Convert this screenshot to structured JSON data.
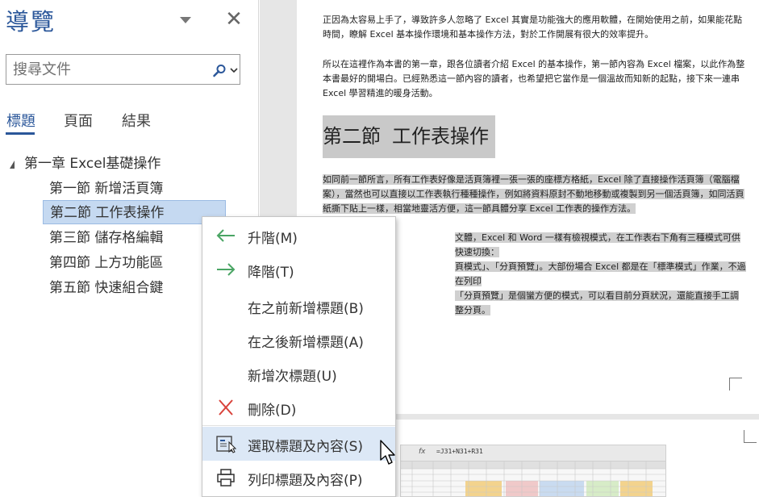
{
  "nav": {
    "title": "導覽",
    "close_glyph": "✕",
    "search": {
      "placeholder": "搜尋文件",
      "value": ""
    },
    "tabs": [
      {
        "label": "標題",
        "active": true
      },
      {
        "label": "頁面",
        "active": false
      },
      {
        "label": "結果",
        "active": false
      }
    ],
    "tree": {
      "chapter": "第一章 Excel基礎操作",
      "sections": [
        {
          "label": "第一節 新增活頁簿",
          "selected": false
        },
        {
          "label": "第二節 工作表操作",
          "selected": true
        },
        {
          "label": "第三節 儲存格編輯",
          "selected": false
        },
        {
          "label": "第四節 上方功能區",
          "selected": false
        },
        {
          "label": "第五節 快速組合鍵",
          "selected": false
        }
      ]
    }
  },
  "document": {
    "para1": "正因為太容易上手了，導致許多人忽略了 Excel 其實是功能強大的應用軟體，在開始使用之前，如果能花點時間，瞭解 Excel 基本操作環境和基本操作方法，對於工作開展有很大的效率提升。",
    "para2": "所以在這裡作為本書的第一章，跟各位讀者介紹 Excel 的基本操作，第一節內容為 Excel 檔案，以此作為整本書最好的開場白。已經熟悉這一節內容的讀者，也希望把它當作是一個溫故而知新的起點，接下來一連串 Excel 學習精進的暖身活動。",
    "heading_part1": "第二節",
    "heading_part2": "工作表操作",
    "para3": "如同前一節所言，所有工作表好像是活頁簿裡一張一張的座標方格紙，Excel 除了直接操作活頁簿（電腦檔案），當然也可以直接以工作表執行種種操作，例如將資料原封不動地移動或複製到另一個活頁簿，如同活頁紙撕下貼上一樣，相當地靈活方便，這一節具體分享 Excel 工作表的操作方法。",
    "para4_line1": "文體，Excel 和 Word 一樣有檢視模式，在工作表右下角有三種模式可供快速切換：",
    "para4_line2": "頁模式」、「分頁預覽」。大部份場合 Excel 都是在「標準模式」作業，不過在列印",
    "para4_line3": "「分頁預覽」是個蠻方便的模式，可以看目前分頁狀況，還能直接手工調整分頁。",
    "excel_fx": "fx",
    "excel_formula": "=J31+N31+R31"
  },
  "context_menu": {
    "items": [
      {
        "label": "升階(M)",
        "icon": "arrow-left-icon"
      },
      {
        "label": "降階(T)",
        "icon": "arrow-right-icon"
      },
      {
        "label": "在之前新增標題(B)",
        "icon": ""
      },
      {
        "label": "在之後新增標題(A)",
        "icon": ""
      },
      {
        "label": "新增次標題(U)",
        "icon": ""
      },
      {
        "label": "刪除(D)",
        "icon": "delete-x-icon"
      },
      {
        "label": "選取標題及內容(S)",
        "icon": "select-heading-icon",
        "hover": true
      },
      {
        "label": "列印標題及內容(P)",
        "icon": "printer-icon"
      }
    ]
  },
  "colors": {
    "accent": "#2b579a",
    "selected_bg": "#c5d9f1",
    "menu_hover_bg": "#dce8f6",
    "arrow_green": "#4aa564",
    "delete_red": "#d9433b"
  }
}
